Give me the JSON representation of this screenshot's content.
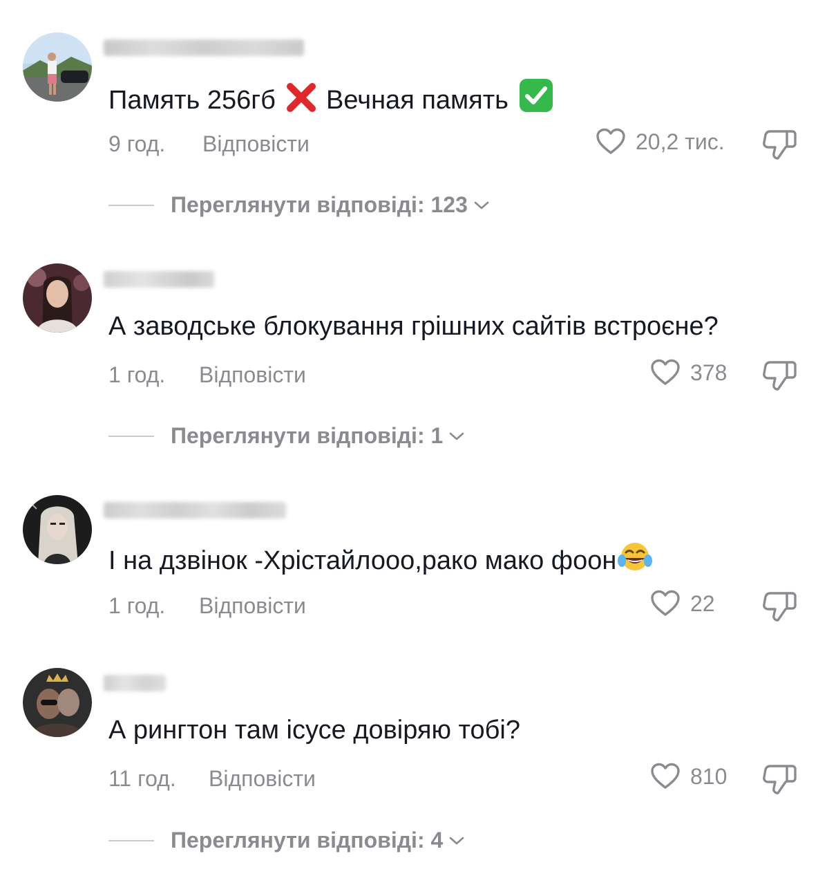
{
  "comments": [
    {
      "text_before": "Память 256гб ",
      "text_mid": " Вечная память ",
      "time": "9 год.",
      "reply_label": "Відповісти",
      "likes": "20,2 тис.",
      "view_replies": "Переглянути відповіді: 123"
    },
    {
      "text": "А заводське блокування грішних сайтів встроєне?",
      "time": "1 год.",
      "reply_label": "Відповісти",
      "likes": "378",
      "view_replies": "Переглянути відповіді: 1"
    },
    {
      "text": "І на дзвінок -Хрістайлооо,рако мако фоон",
      "time": "1 год.",
      "reply_label": "Відповісти",
      "likes": "22"
    },
    {
      "text": "А рингтон там ісусе довіряю тобі?",
      "time": "11 год.",
      "reply_label": "Відповісти",
      "likes": "810",
      "view_replies": "Переглянути відповіді: 4"
    }
  ],
  "icons": {
    "like": "heart-outline-icon",
    "dislike": "thumbs-down-icon",
    "chevron": "chevron-down-icon",
    "emoji_cross": "cross-mark-emoji",
    "emoji_check": "check-mark-button-emoji",
    "emoji_laugh": "tears-of-joy-emoji"
  },
  "colors": {
    "text": "#161823",
    "muted": "#8a8b91",
    "divider": "#c8c9cc",
    "cross": "#e0272b",
    "check": "#34b94a"
  }
}
